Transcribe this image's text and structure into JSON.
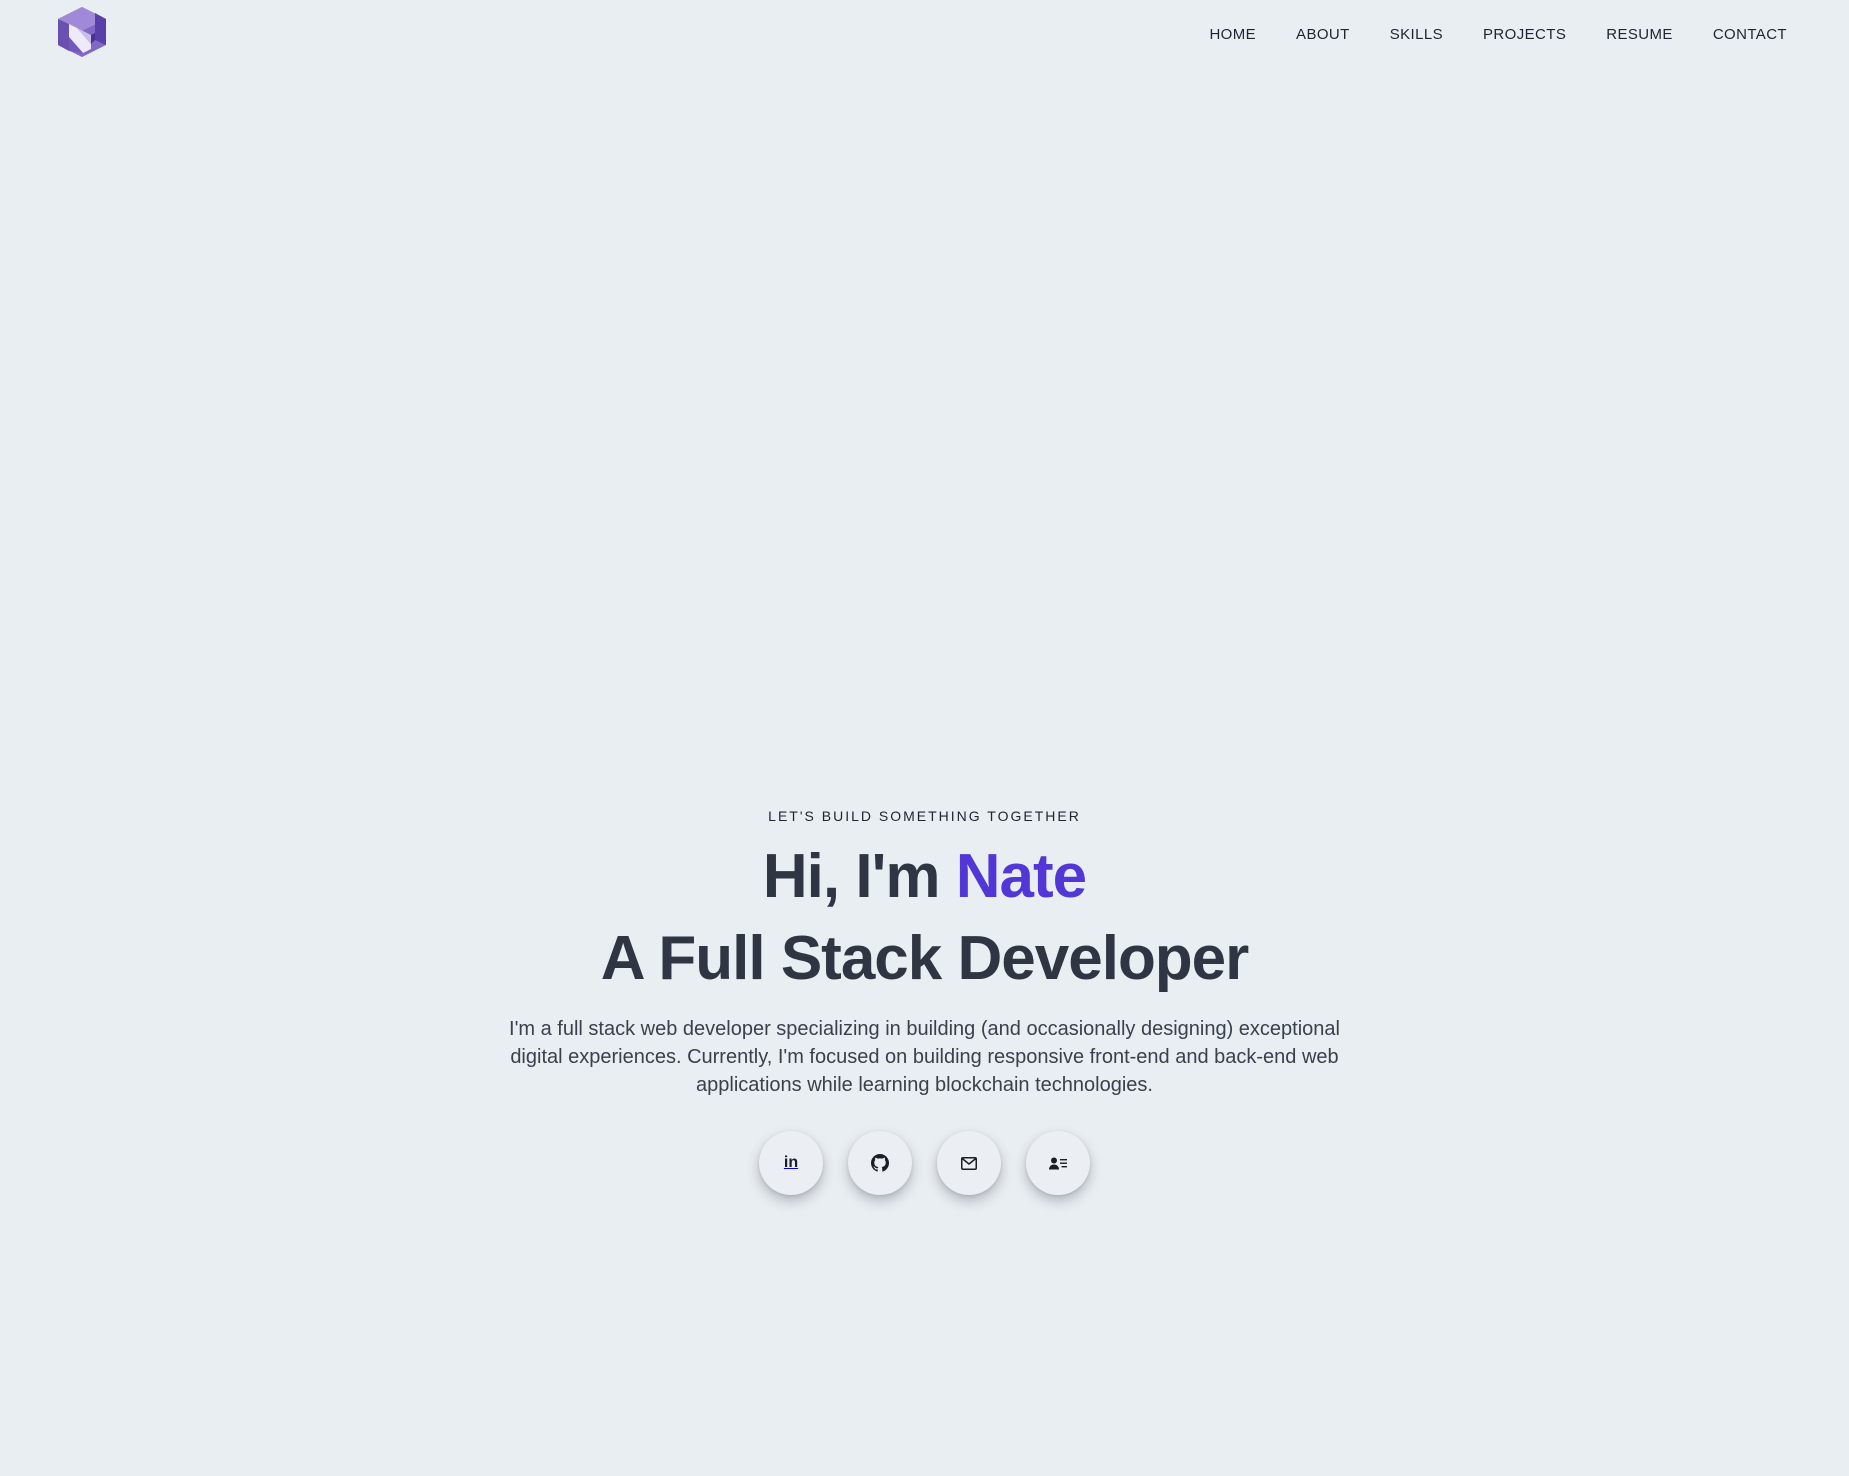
{
  "nav": {
    "logo_name": "N logo",
    "links": [
      {
        "label": "HOME"
      },
      {
        "label": "ABOUT"
      },
      {
        "label": "SKILLS"
      },
      {
        "label": "PROJECTS"
      },
      {
        "label": "RESUME"
      },
      {
        "label": "CONTACT"
      }
    ]
  },
  "hero": {
    "tagline": "LET'S BUILD SOMETHING TOGETHER",
    "greeting_prefix": "Hi, I'm ",
    "name": "Nate",
    "title": "A Full Stack Developer",
    "description": "I'm a full stack web developer specializing in building (and occasionally designing) exceptional digital experiences. Currently, I'm focused on building responsive front-end and back-end web applications while learning blockchain technologies."
  },
  "social": {
    "linkedin_text": "in",
    "icons": [
      "linkedin-icon",
      "github-icon",
      "mail-icon",
      "contact-card-icon"
    ]
  },
  "colors": {
    "background": "#e9eef2",
    "accent": "#5236d6",
    "text_dark": "#2f3542",
    "logo_purple": "#6f4fb3"
  }
}
